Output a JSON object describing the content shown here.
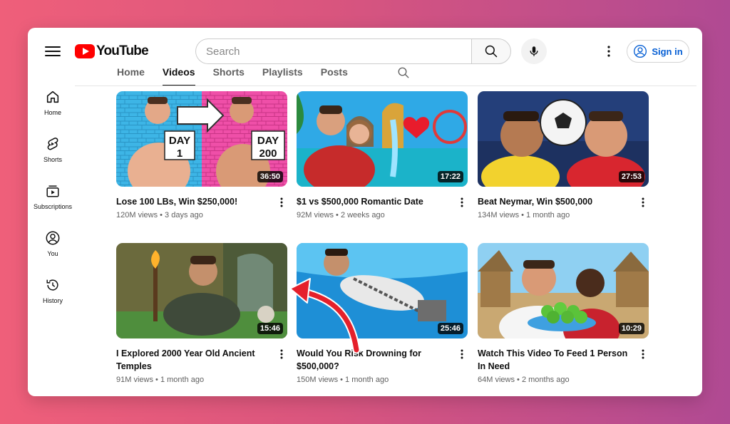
{
  "header": {
    "logo_text": "YouTube",
    "search_placeholder": "Search",
    "signin_label": "Sign in"
  },
  "tabs": [
    {
      "label": "Home",
      "active": false
    },
    {
      "label": "Videos",
      "active": true
    },
    {
      "label": "Shorts",
      "active": false
    },
    {
      "label": "Playlists",
      "active": false
    },
    {
      "label": "Posts",
      "active": false
    }
  ],
  "sidebar": {
    "items": [
      {
        "label": "Home",
        "icon": "home-icon"
      },
      {
        "label": "Shorts",
        "icon": "shorts-icon"
      },
      {
        "label": "Subscriptions",
        "icon": "subscriptions-icon"
      },
      {
        "label": "You",
        "icon": "you-icon"
      },
      {
        "label": "History",
        "icon": "history-icon"
      }
    ]
  },
  "videos": [
    {
      "title": "Lose 100 LBs, Win $250,000!",
      "views": "120M views",
      "age": "3 days ago",
      "duration": "36:50",
      "thumb_text_1": "DAY\n1",
      "thumb_text_2": "DAY\n200"
    },
    {
      "title": "$1 vs $500,000 Romantic Date",
      "views": "92M views",
      "age": "2 weeks ago",
      "duration": "17:22"
    },
    {
      "title": "Beat Neymar, Win $500,000",
      "views": "134M views",
      "age": "1 month ago",
      "duration": "27:53"
    },
    {
      "title": "I Explored 2000 Year Old Ancient Temples",
      "views": "91M views",
      "age": "1 month ago",
      "duration": "15:46"
    },
    {
      "title": "Would You Risk Drowning for $500,000?",
      "views": "150M views",
      "age": "1 month ago",
      "duration": "25:46"
    },
    {
      "title": "Watch This Video To Feed 1 Person In Need",
      "views": "64M views",
      "age": "2 months ago",
      "duration": "10:29"
    }
  ],
  "colors": {
    "brand_red": "#ff0000",
    "link_blue": "#065fd4",
    "annotation_arrow": "#e5202b"
  }
}
